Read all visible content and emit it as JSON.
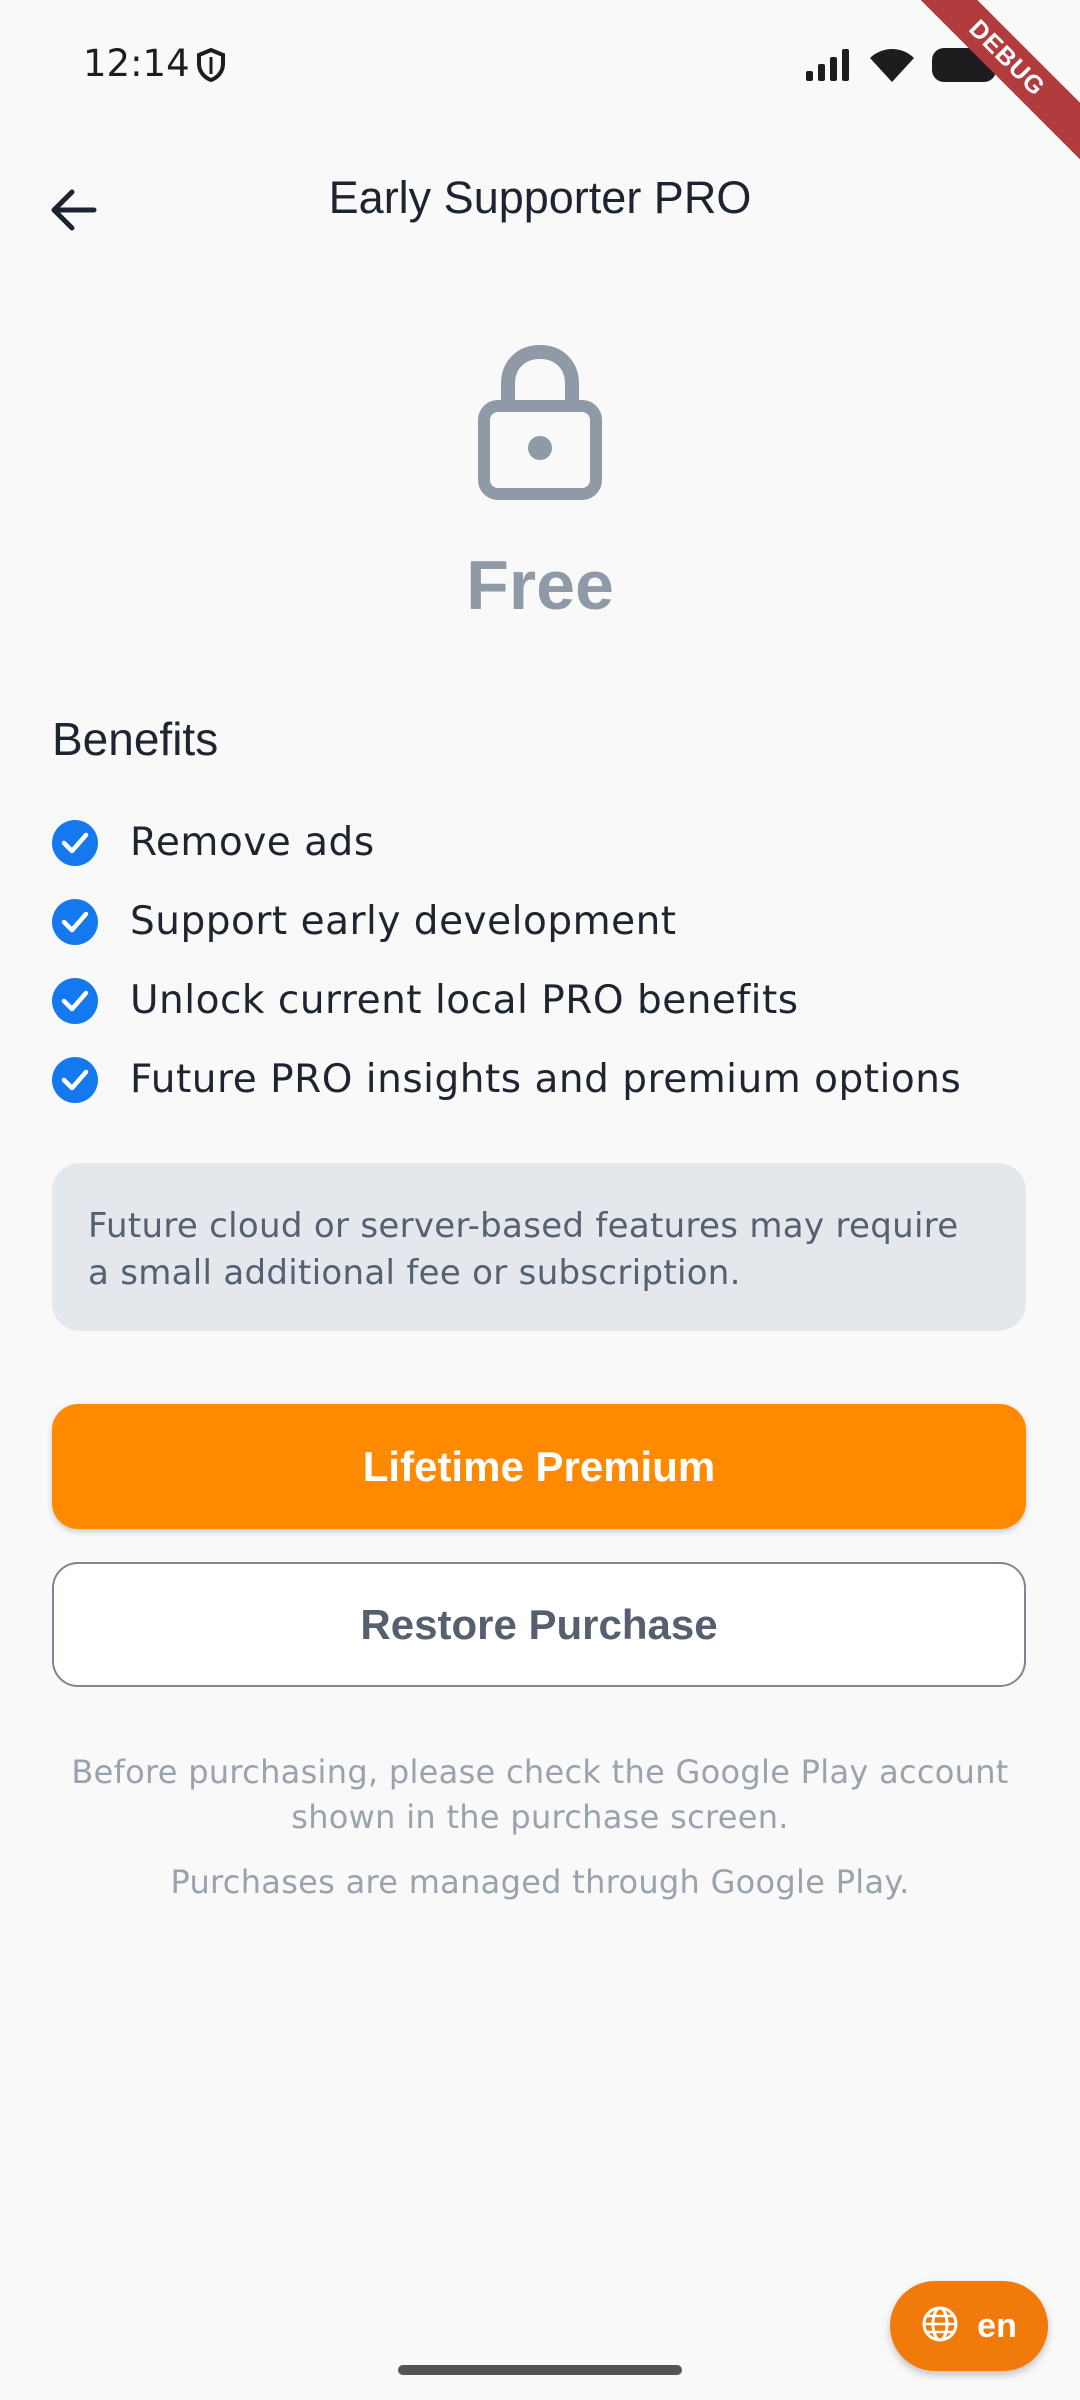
{
  "status_bar": {
    "time": "12:14",
    "icons": [
      "shield-icon",
      "signal-icon",
      "wifi-icon",
      "battery-icon"
    ]
  },
  "debug_banner": "DEBUG",
  "app_bar": {
    "title": "Early Supporter PRO",
    "back_icon": "back-arrow-icon"
  },
  "hero": {
    "icon": "lock-icon",
    "price": "Free"
  },
  "benefits": {
    "heading": "Benefits",
    "items": [
      {
        "label": "Remove ads"
      },
      {
        "label": "Support early development"
      },
      {
        "label": "Unlock current local PRO benefits"
      },
      {
        "label": "Future PRO insights and premium options"
      }
    ]
  },
  "note": "Future cloud or server-based features may require a small additional fee or subscription.",
  "buttons": {
    "primary": "Lifetime Premium",
    "secondary": "Restore Purchase"
  },
  "footer": {
    "line1": "Before purchasing, please check the Google Play account shown in the purchase screen.",
    "line2": "Purchases are managed through Google Play."
  },
  "language_fab": {
    "icon": "globe-icon",
    "label": "en"
  },
  "colors": {
    "accent": "#ff8a00",
    "check": "#1478ee",
    "background": "#f9f9fa"
  }
}
